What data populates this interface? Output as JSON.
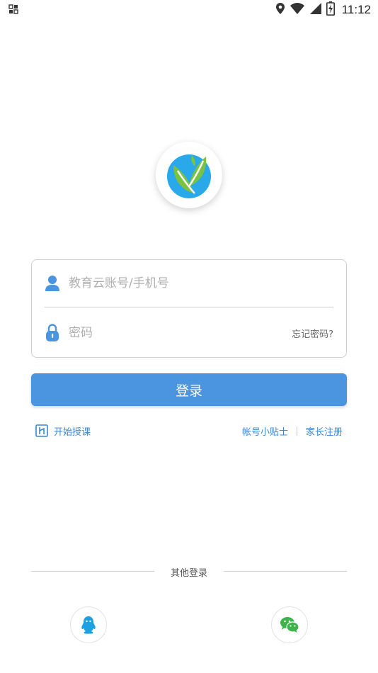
{
  "status_bar": {
    "time": "11:12",
    "icons": [
      "notification-icon",
      "location-icon",
      "wifi-icon",
      "signal-icon",
      "battery-charging-icon"
    ]
  },
  "logo": {
    "icon": "leaf-logo-icon",
    "colors": {
      "blue": "#29a8ea",
      "green": "#7cc242"
    }
  },
  "login": {
    "account_placeholder": "教育云账号/手机号",
    "account_value": "",
    "password_placeholder": "密码",
    "password_value": "",
    "forgot_label": "忘记密码?",
    "login_label": "登录"
  },
  "links": {
    "start_class": "开始授课",
    "account_tips": "帐号小贴士",
    "parent_register": "家长注册"
  },
  "other_login": {
    "label": "其他登录",
    "providers": [
      "qq-icon",
      "wechat-icon"
    ]
  },
  "colors": {
    "accent": "#4a94e0",
    "link": "#3a87d6",
    "wechat": "#3bb449",
    "qq": "#1fa0e0"
  }
}
